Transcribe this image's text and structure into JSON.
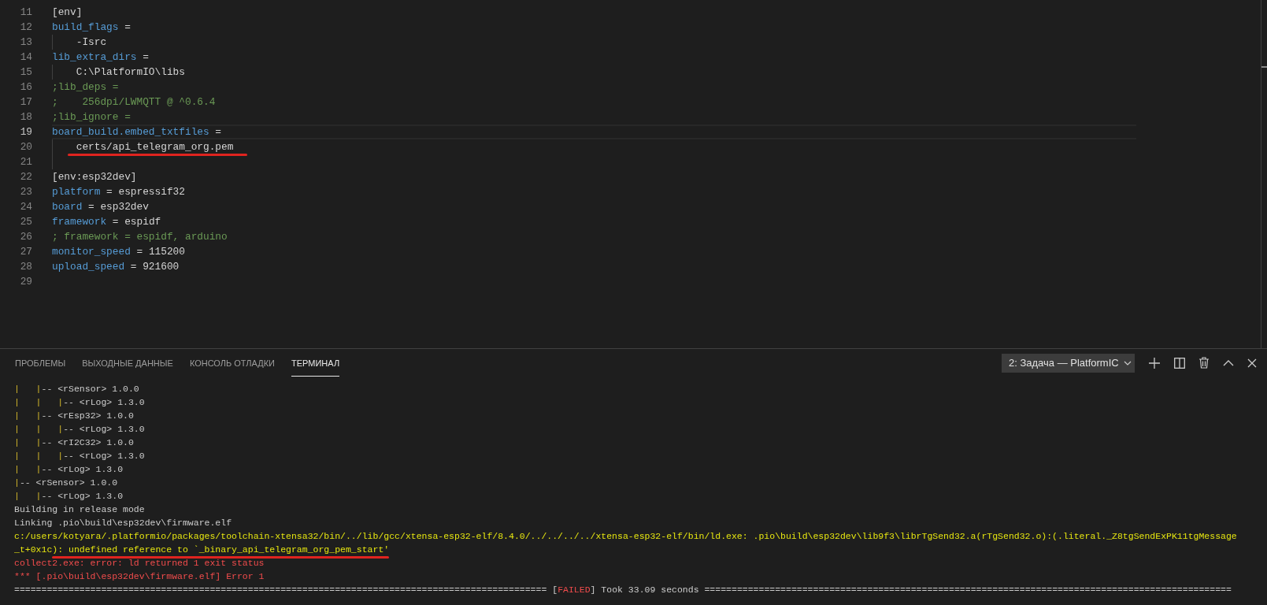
{
  "editor": {
    "lines": [
      {
        "number": "11",
        "current": false,
        "guide": false,
        "underlined": false,
        "tokens": [
          {
            "text": "[env]",
            "kind": "plain"
          }
        ]
      },
      {
        "number": "12",
        "current": false,
        "guide": false,
        "underlined": false,
        "tokens": [
          {
            "text": "build_flags",
            "kind": "key"
          },
          {
            "text": " =",
            "kind": "plain"
          }
        ]
      },
      {
        "number": "13",
        "current": false,
        "guide": true,
        "underlined": false,
        "tokens": [
          {
            "text": "    -Isrc",
            "kind": "plain"
          }
        ]
      },
      {
        "number": "14",
        "current": false,
        "guide": false,
        "underlined": false,
        "tokens": [
          {
            "text": "lib_extra_dirs",
            "kind": "key"
          },
          {
            "text": " =",
            "kind": "plain"
          }
        ]
      },
      {
        "number": "15",
        "current": false,
        "guide": true,
        "underlined": false,
        "tokens": [
          {
            "text": "    C:\\PlatformIO\\libs",
            "kind": "plain"
          }
        ]
      },
      {
        "number": "16",
        "current": false,
        "guide": false,
        "underlined": false,
        "tokens": [
          {
            "text": ";lib_deps =",
            "kind": "comment"
          }
        ]
      },
      {
        "number": "17",
        "current": false,
        "guide": false,
        "underlined": false,
        "tokens": [
          {
            "text": ";    256dpi/LWMQTT @ ^0.6.4",
            "kind": "comment"
          }
        ]
      },
      {
        "number": "18",
        "current": false,
        "guide": false,
        "underlined": false,
        "tokens": [
          {
            "text": ";lib_ignore =",
            "kind": "comment"
          }
        ]
      },
      {
        "number": "19",
        "current": true,
        "guide": false,
        "underlined": false,
        "tokens": [
          {
            "text": "board_build.embed_txtfiles",
            "kind": "key"
          },
          {
            "text": " =",
            "kind": "plain"
          }
        ]
      },
      {
        "number": "20",
        "current": false,
        "guide": true,
        "underlined": true,
        "tokens": [
          {
            "text": "    certs/api_telegram_org.pem",
            "kind": "plain"
          }
        ]
      },
      {
        "number": "21",
        "current": false,
        "guide": true,
        "underlined": false
      },
      {
        "number": "22",
        "current": false,
        "guide": false,
        "underlined": false,
        "tokens": [
          {
            "text": "[env:esp32dev]",
            "kind": "plain"
          }
        ]
      },
      {
        "number": "23",
        "current": false,
        "guide": false,
        "underlined": false,
        "tokens": [
          {
            "text": "platform",
            "kind": "key"
          },
          {
            "text": " = espressif32",
            "kind": "plain"
          }
        ]
      },
      {
        "number": "24",
        "current": false,
        "guide": false,
        "underlined": false,
        "tokens": [
          {
            "text": "board",
            "kind": "key"
          },
          {
            "text": " = esp32dev",
            "kind": "plain"
          }
        ]
      },
      {
        "number": "25",
        "current": false,
        "guide": false,
        "underlined": false,
        "tokens": [
          {
            "text": "framework",
            "kind": "key"
          },
          {
            "text": " = espidf",
            "kind": "plain"
          }
        ]
      },
      {
        "number": "26",
        "current": false,
        "guide": false,
        "underlined": false,
        "tokens": [
          {
            "text": "; framework = espidf, arduino",
            "kind": "comment"
          }
        ]
      },
      {
        "number": "27",
        "current": false,
        "guide": false,
        "underlined": false,
        "tokens": [
          {
            "text": "monitor_speed",
            "kind": "key"
          },
          {
            "text": " = 115200",
            "kind": "plain"
          }
        ]
      },
      {
        "number": "28",
        "current": false,
        "guide": false,
        "underlined": false,
        "tokens": [
          {
            "text": "upload_speed",
            "kind": "key"
          },
          {
            "text": " = 921600",
            "kind": "plain"
          }
        ]
      },
      {
        "number": "29",
        "current": false,
        "guide": false,
        "underlined": false
      }
    ]
  },
  "panel": {
    "tabs": [
      {
        "label": "ПРОБЛЕМЫ",
        "selected": false
      },
      {
        "label": "ВЫХОДНЫЕ ДАННЫЕ",
        "selected": false
      },
      {
        "label": "КОНСОЛЬ ОТЛАДКИ",
        "selected": false
      },
      {
        "label": "ТЕРМИНАЛ",
        "selected": true
      }
    ],
    "terminal_select": {
      "value": "2: Задача — PlatformIC"
    },
    "terminal": {
      "lines": [
        {
          "underlined": false,
          "segments": [
            {
              "text": "|   |",
              "kind": "pipe"
            },
            {
              "text": "-- <rSensor> 1.0.0",
              "kind": "plain"
            }
          ]
        },
        {
          "underlined": false,
          "segments": [
            {
              "text": "|   |   |",
              "kind": "pipe"
            },
            {
              "text": "-- <rLog> 1.3.0",
              "kind": "plain"
            }
          ]
        },
        {
          "underlined": false,
          "segments": [
            {
              "text": "|   |",
              "kind": "pipe"
            },
            {
              "text": "-- <rEsp32> 1.0.0",
              "kind": "plain"
            }
          ]
        },
        {
          "underlined": false,
          "segments": [
            {
              "text": "|   |   |",
              "kind": "pipe"
            },
            {
              "text": "-- <rLog> 1.3.0",
              "kind": "plain"
            }
          ]
        },
        {
          "underlined": false,
          "segments": [
            {
              "text": "|   |",
              "kind": "pipe"
            },
            {
              "text": "-- <rI2C32> 1.0.0",
              "kind": "plain"
            }
          ]
        },
        {
          "underlined": false,
          "segments": [
            {
              "text": "|   |   |",
              "kind": "pipe"
            },
            {
              "text": "-- <rLog> 1.3.0",
              "kind": "plain"
            }
          ]
        },
        {
          "underlined": false,
          "segments": [
            {
              "text": "|   |",
              "kind": "pipe"
            },
            {
              "text": "-- <rLog> 1.3.0",
              "kind": "plain"
            }
          ]
        },
        {
          "underlined": false,
          "segments": [
            {
              "text": "|",
              "kind": "pipe"
            },
            {
              "text": "-- <rSensor> 1.0.0",
              "kind": "plain"
            }
          ]
        },
        {
          "underlined": false,
          "segments": [
            {
              "text": "|   |",
              "kind": "pipe"
            },
            {
              "text": "-- <rLog> 1.3.0",
              "kind": "plain"
            }
          ]
        },
        {
          "underlined": false,
          "segments": [
            {
              "text": "Building in release mode",
              "kind": "plain"
            }
          ]
        },
        {
          "underlined": false,
          "segments": [
            {
              "text": "Linking .pio\\build\\esp32dev\\firmware.elf",
              "kind": "plain"
            }
          ]
        },
        {
          "underlined": false,
          "segments": [
            {
              "text": "c:/users/kotyara/.platformio/packages/toolchain-xtensa32/bin/../lib/gcc/xtensa-esp32-elf/8.4.0/../../../../xtensa-esp32-elf/bin/ld.exe: .pio\\build\\esp32dev\\lib9f3\\librTgSend32.a(rTgSend32.o):(.literal._Z8tgSendExPK11tgMessage",
              "kind": "warn"
            }
          ]
        },
        {
          "underlined": true,
          "segments": [
            {
              "text": "_t+0x1c",
              "kind": "warn"
            },
            {
              "text": "): undefined reference to `_binary_api_telegram_org_pem_start'",
              "kind": "warn"
            }
          ]
        },
        {
          "underlined": false,
          "segments": [
            {
              "text": "collect2.exe: error: ld returned 1 exit status",
              "kind": "error"
            }
          ]
        },
        {
          "underlined": false,
          "segments": [
            {
              "text": "*** [.pio\\build\\esp32dev\\firmware.elf] Error 1",
              "kind": "error"
            }
          ]
        },
        {
          "underlined": false,
          "segments": [
            {
              "text": "================================================================================================== [",
              "kind": "plain"
            },
            {
              "text": "FAILED",
              "kind": "error"
            },
            {
              "text": "] Took 33.09 seconds =================================================================================================",
              "kind": "plain"
            }
          ]
        }
      ]
    }
  }
}
